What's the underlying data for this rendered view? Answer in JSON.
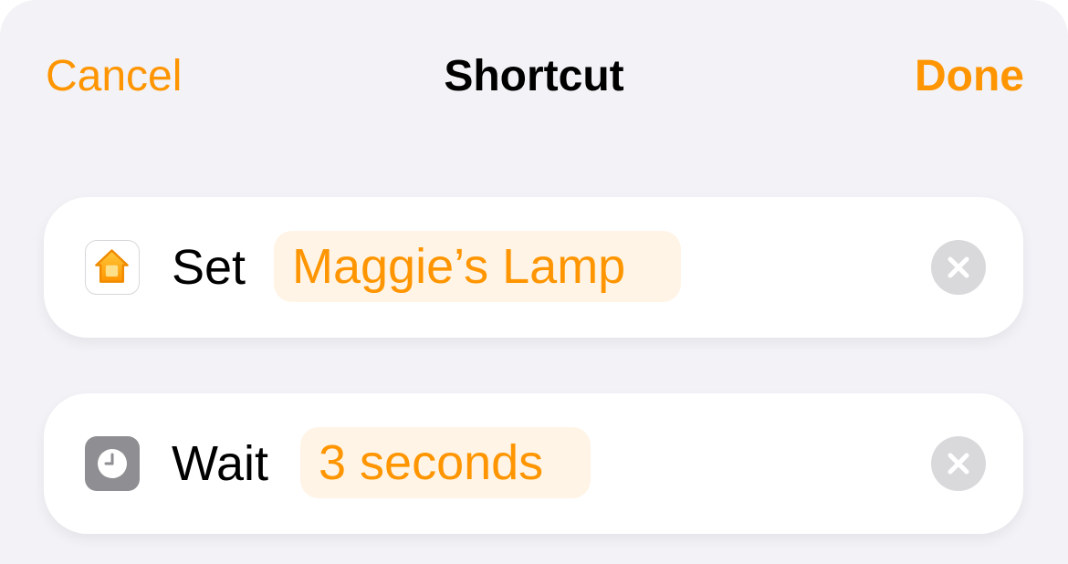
{
  "nav": {
    "cancel_label": "Cancel",
    "title": "Shortcut",
    "done_label": "Done"
  },
  "actions": [
    {
      "icon": "home-icon",
      "verb": "Set",
      "parameter": "Maggie’s Lamp"
    },
    {
      "icon": "clock-icon",
      "verb": "Wait",
      "parameter": "3 seconds"
    }
  ],
  "colors": {
    "accent": "#ff9500",
    "background": "#f2f2f7",
    "card": "#ffffff",
    "token_background": "#fff4e6",
    "remove_button": "#d9d9dc",
    "clock_icon_background": "#8e8e93"
  }
}
